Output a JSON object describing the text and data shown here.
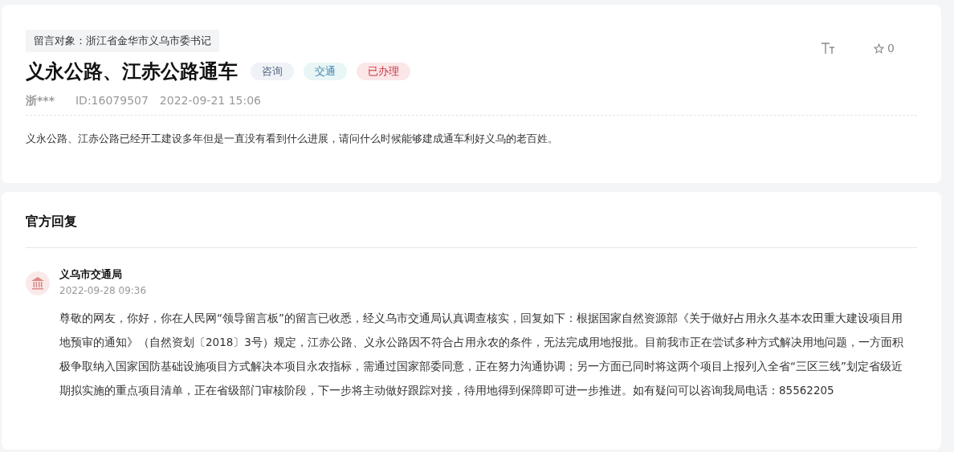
{
  "message": {
    "target": "留言对象：浙江省金华市义乌市委书记",
    "title": "义永公路、江赤公路通车",
    "tags": [
      {
        "label": "咨询",
        "kind": "type"
      },
      {
        "label": "交通",
        "kind": "field"
      },
      {
        "label": "已办理",
        "kind": "status"
      }
    ],
    "author": "浙***",
    "id": "ID:16079507",
    "time": "2022-09-21 15:06",
    "favorites": "0",
    "body": "义永公路、江赤公路已经开工建设多年但是一直没有看到什么进展，请问什么时候能够建成通车利好义乌的老百姓。"
  },
  "reply": {
    "heading": "官方回复",
    "org": "义乌市交通局",
    "time": "2022-09-28 09:36",
    "body": "尊敬的网友，你好，你在人民网“领导留言板”的留言已收悉，经义乌市交通局认真调查核实，回复如下：根据国家自然资源部《关于做好占用永久基本农田重大建设项目用地预审的通知》（自然资划〔2018〕3号）规定，江赤公路、义永公路因不符合占用永农的条件，无法完成用地报批。目前我市正在尝试多种方式解决用地问题，一方面积极争取纳入国家国防基础设施项目方式解决本项目永农指标，需通过国家部委同意，正在努力沟通协调；另一方面已同时将这两个项目上报列入全省“三区三线”划定省级近期拟实施的重点项目清单，正在省级部门审核阶段，下一步将主动做好跟踪对接，待用地得到保障即可进一步推进。如有疑问可以咨询我局电话：85562205"
  }
}
